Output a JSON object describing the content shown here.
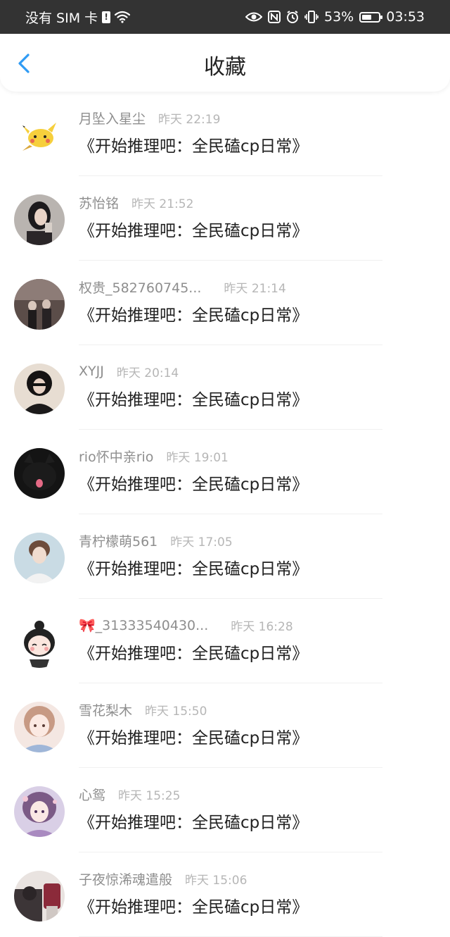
{
  "statusbar": {
    "carrier": "没有 SIM 卡",
    "sim_badge": "!",
    "battery_percent": "53%",
    "time": "03:53"
  },
  "navbar": {
    "title": "收藏"
  },
  "items": [
    {
      "user": "月坠入星尘",
      "time": "昨天 22:19",
      "title": "《开始推理吧：全民磕cp日常》"
    },
    {
      "user": "苏怡铭",
      "time": "昨天 21:52",
      "title": "《开始推理吧：全民磕cp日常》"
    },
    {
      "user": "权贵_582760745...",
      "time": "昨天 21:14",
      "title": "《开始推理吧：全民磕cp日常》"
    },
    {
      "user": "XYJJ",
      "time": "昨天 20:14",
      "title": "《开始推理吧：全民磕cp日常》"
    },
    {
      "user": "rio怀中亲rio",
      "time": "昨天 19:01",
      "title": "《开始推理吧：全民磕cp日常》"
    },
    {
      "user": "青柠檬萌561",
      "time": "昨天 17:05",
      "title": "《开始推理吧：全民磕cp日常》"
    },
    {
      "user": "🎀_31333540430...",
      "time": "昨天 16:28",
      "title": "《开始推理吧：全民磕cp日常》"
    },
    {
      "user": "雪花梨木",
      "time": "昨天 15:50",
      "title": "《开始推理吧：全民磕cp日常》"
    },
    {
      "user": "心鸳",
      "time": "昨天 15:25",
      "title": "《开始推理吧：全民磕cp日常》"
    },
    {
      "user": "子夜惊浠魂遣般",
      "time": "昨天 15:06",
      "title": "《开始推理吧：全民磕cp日常》"
    }
  ],
  "colors": {
    "accent_back": "#2f9bf4",
    "statusbar_bg": "#333333",
    "username": "#8e8e8e",
    "timestamp": "#b6b6b6",
    "title_text": "#222222"
  }
}
